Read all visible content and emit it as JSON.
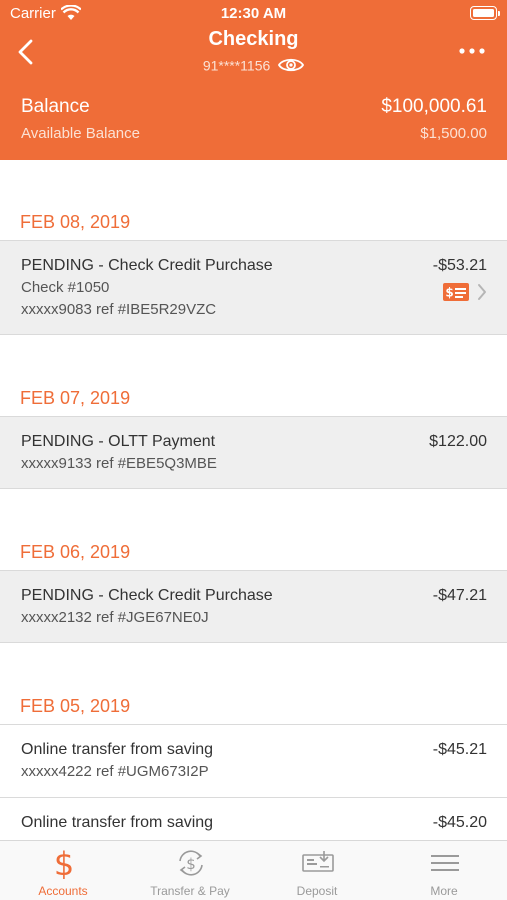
{
  "status_bar": {
    "carrier": "Carrier",
    "time": "12:30 AM"
  },
  "header": {
    "title": "Checking",
    "account_number": "91****1156",
    "balance_label": "Balance",
    "balance_value": "$100,000.61",
    "available_label": "Available Balance",
    "available_value": "$1,500.00"
  },
  "colors": {
    "accent": "#ef6d38",
    "row_gray": "#efefef"
  },
  "groups": [
    {
      "date": "FEB 08, 2019",
      "transactions": [
        {
          "title": "PENDING - Check Credit Purchase",
          "check": "Check #1050",
          "ref": "xxxxx9083 ref #IBE5R29VZC",
          "amount": "-$53.21"
        }
      ]
    },
    {
      "date": "FEB 07, 2019",
      "transactions": [
        {
          "title": "PENDING - OLTT Payment",
          "ref": "xxxxx9133 ref #EBE5Q3MBE",
          "amount": "$122.00"
        }
      ]
    },
    {
      "date": "FEB 06, 2019",
      "transactions": [
        {
          "title": "PENDING - Check Credit Purchase",
          "ref": "xxxxx2132 ref #JGE67NE0J",
          "amount": "-$47.21"
        }
      ]
    },
    {
      "date": "FEB 05, 2019",
      "transactions": [
        {
          "title": "Online transfer from saving",
          "ref": "xxxxx4222 ref #UGM673I2P",
          "amount": "-$45.21"
        },
        {
          "title": "Online transfer from saving",
          "amount": "-$45.20"
        }
      ]
    }
  ],
  "tabbar": {
    "tabs": [
      {
        "label": "Accounts",
        "icon": "dollar-icon",
        "active": true
      },
      {
        "label": "Transfer & Pay",
        "icon": "transfer-icon",
        "active": false
      },
      {
        "label": "Deposit",
        "icon": "deposit-check-icon",
        "active": false
      },
      {
        "label": "More",
        "icon": "menu-icon",
        "active": false
      }
    ]
  }
}
